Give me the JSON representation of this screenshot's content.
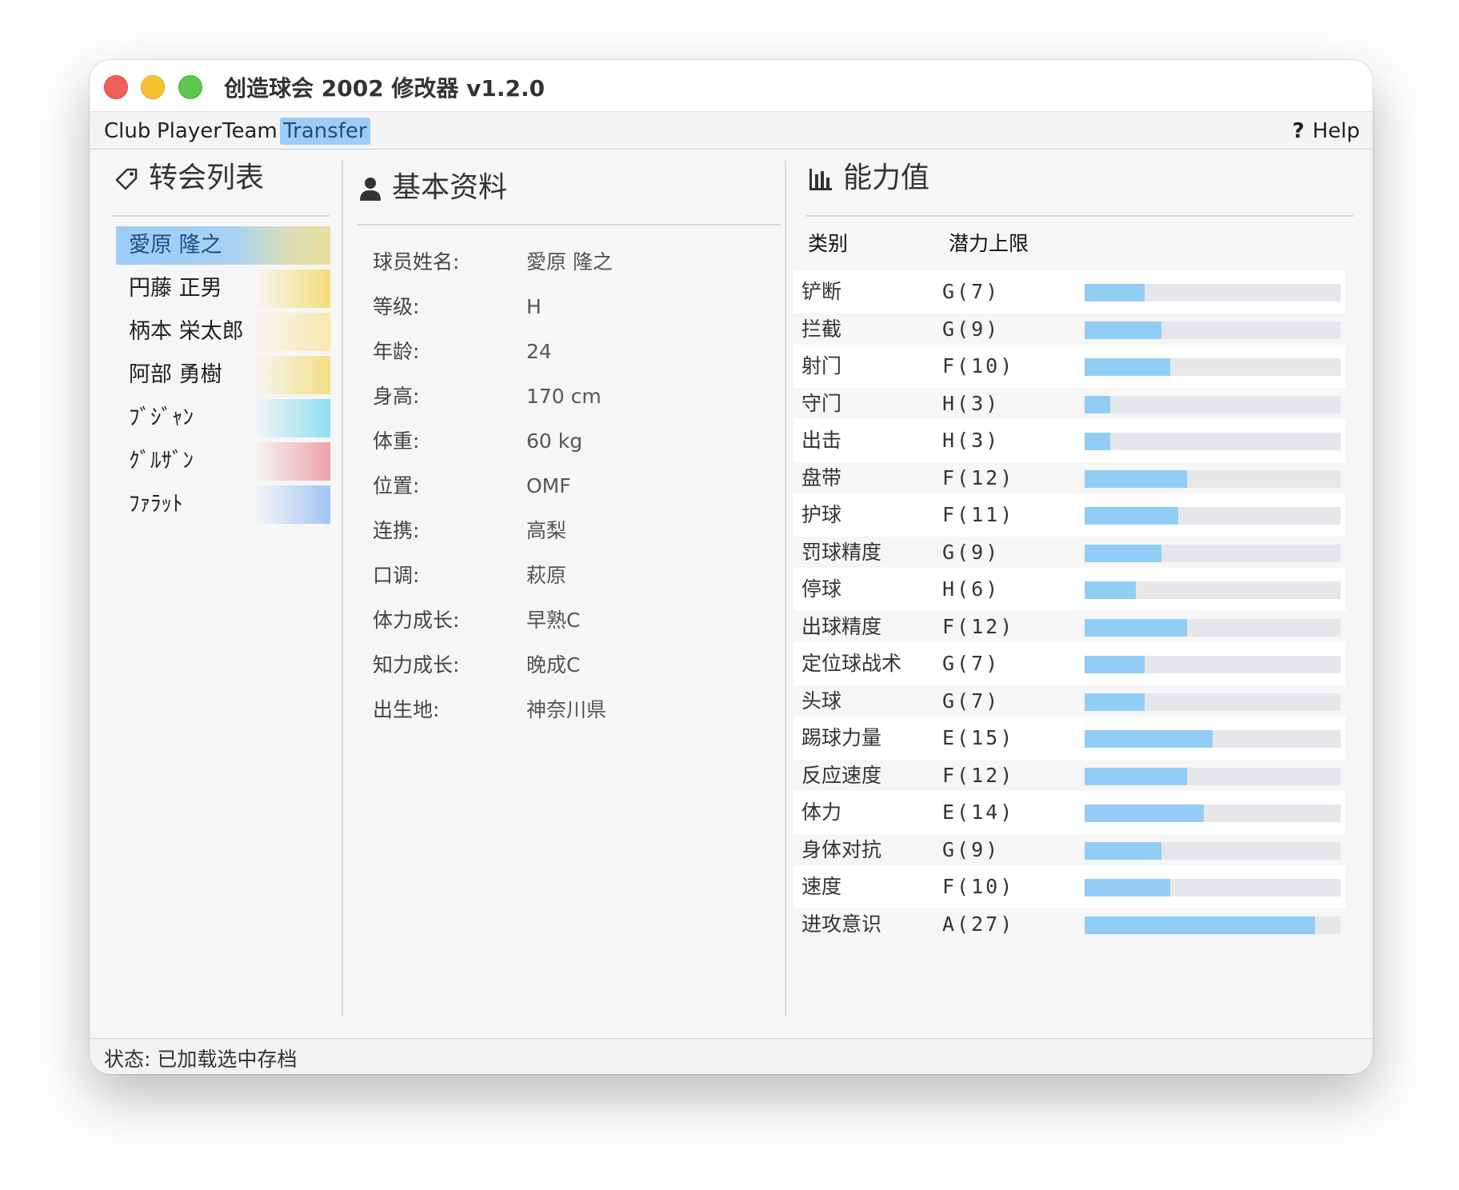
{
  "window": {
    "title": "创造球会 2002 修改器 v1.2.0"
  },
  "menu": {
    "items": [
      {
        "label": "Club",
        "active": false
      },
      {
        "label": "Player",
        "active": false
      },
      {
        "label": "Team",
        "active": false
      },
      {
        "label": "Transfer",
        "active": true
      }
    ],
    "help": {
      "icon_text": "?",
      "label": "Help"
    }
  },
  "transfer_list": {
    "title": "转会列表",
    "icon": "tag-icon",
    "items": [
      {
        "name": "愛原 隆之",
        "swatch": "#ecdf9c",
        "selected": true
      },
      {
        "name": "円藤 正男",
        "swatch": "#f3dd7c",
        "selected": false
      },
      {
        "name": "柄本 栄太郎",
        "swatch": "#f6e8ae",
        "selected": false
      },
      {
        "name": "阿部 勇樹",
        "swatch": "#f3df84",
        "selected": false
      },
      {
        "name": "ﾌﾞｼﾞｬﾝ",
        "swatch": "#8fdff0",
        "selected": false
      },
      {
        "name": "ｸﾞﾙｻﾞﾝ",
        "swatch": "#eba4a8",
        "selected": false
      },
      {
        "name": "ﾌｧﾗｯﾄ",
        "swatch": "#a4c5f3",
        "selected": false
      }
    ]
  },
  "basic_info": {
    "title": "基本资料",
    "icon": "person-icon",
    "fields": [
      {
        "label": "球员姓名:",
        "value": "愛原 隆之"
      },
      {
        "label": "等级:",
        "value": "H"
      },
      {
        "label": "年龄:",
        "value": "24"
      },
      {
        "label": "身高:",
        "value": "170 cm"
      },
      {
        "label": "体重:",
        "value": "60 kg"
      },
      {
        "label": "位置:",
        "value": "OMF"
      },
      {
        "label": "连携:",
        "value": "高梨"
      },
      {
        "label": "口调:",
        "value": "萩原"
      },
      {
        "label": "体力成长:",
        "value": "早熟C"
      },
      {
        "label": "知力成长:",
        "value": "晚成C"
      },
      {
        "label": "出生地:",
        "value": "神奈川県"
      }
    ]
  },
  "abilities": {
    "title": "能力值",
    "icon": "bar-chart-icon",
    "col_category": "类别",
    "col_potential": "潜力上限",
    "bar_scale_max": 30,
    "rows": [
      {
        "category": "铲断",
        "value": "G(7)",
        "score": 7
      },
      {
        "category": "拦截",
        "value": "G(9)",
        "score": 9
      },
      {
        "category": "射门",
        "value": "F(10)",
        "score": 10
      },
      {
        "category": "守门",
        "value": "H(3)",
        "score": 3
      },
      {
        "category": "出击",
        "value": "H(3)",
        "score": 3
      },
      {
        "category": "盘带",
        "value": "F(12)",
        "score": 12
      },
      {
        "category": "护球",
        "value": "F(11)",
        "score": 11
      },
      {
        "category": "罚球精度",
        "value": "G(9)",
        "score": 9
      },
      {
        "category": "停球",
        "value": "H(6)",
        "score": 6
      },
      {
        "category": "出球精度",
        "value": "F(12)",
        "score": 12
      },
      {
        "category": "定位球战术",
        "value": "G(7)",
        "score": 7
      },
      {
        "category": "头球",
        "value": "G(7)",
        "score": 7
      },
      {
        "category": "踢球力量",
        "value": "E(15)",
        "score": 15
      },
      {
        "category": "反应速度",
        "value": "F(12)",
        "score": 12
      },
      {
        "category": "体力",
        "value": "E(14)",
        "score": 14
      },
      {
        "category": "身体对抗",
        "value": "G(9)",
        "score": 9
      },
      {
        "category": "速度",
        "value": "F(10)",
        "score": 10
      },
      {
        "category": "进攻意识",
        "value": "A(27)",
        "score": 27
      }
    ]
  },
  "status": {
    "label": "状态:",
    "text": "已加载选中存档"
  }
}
